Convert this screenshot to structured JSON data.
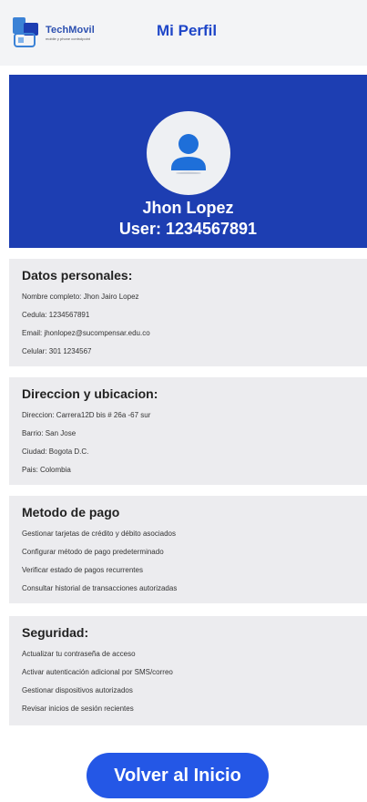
{
  "header": {
    "logo_name": "TechMovil",
    "logo_tagline": "mobile y phone controlpoint",
    "title": "Mi Perfil"
  },
  "profile": {
    "name": "Jhon Lopez",
    "user_line": "User: 1234567891"
  },
  "sections": [
    {
      "title": "Datos personales:",
      "lines": [
        "Nombre completo: Jhon Jairo Lopez",
        "Cedula: 1234567891",
        "Email: jhonlopez@sucompensar.edu.co",
        "Celular: 301 1234567"
      ]
    },
    {
      "title": "Direccion y ubicacion:",
      "lines": [
        "Direccion: Carrera12D bis # 26a -67 sur",
        "Barrio: San Jose",
        "Ciudad: Bogota D.C.",
        "Pais: Colombia"
      ]
    },
    {
      "title": "Metodo de pago",
      "lines": [
        "Gestionar tarjetas de crédito y débito asociados",
        "Configurar método de pago predeterminado",
        "Verificar estado de pagos recurrentes",
        "Consultar historial de transacciones autorizadas"
      ]
    },
    {
      "title": "Seguridad:",
      "lines": [
        "Actualizar tu contraseña de acceso",
        "Activar autenticación adicional por SMS/correo",
        "Gestionar dispositivos autorizados",
        "Revisar inicios de sesión recientes"
      ]
    }
  ],
  "cta_label": "Volver al Inicio",
  "colors": {
    "brand_blue": "#1d3eb2",
    "title_blue": "#1e46c8",
    "button_blue": "#2457e6",
    "card_gray": "#ececef"
  },
  "icons": [
    "app-logo-icon",
    "user-avatar-icon"
  ]
}
